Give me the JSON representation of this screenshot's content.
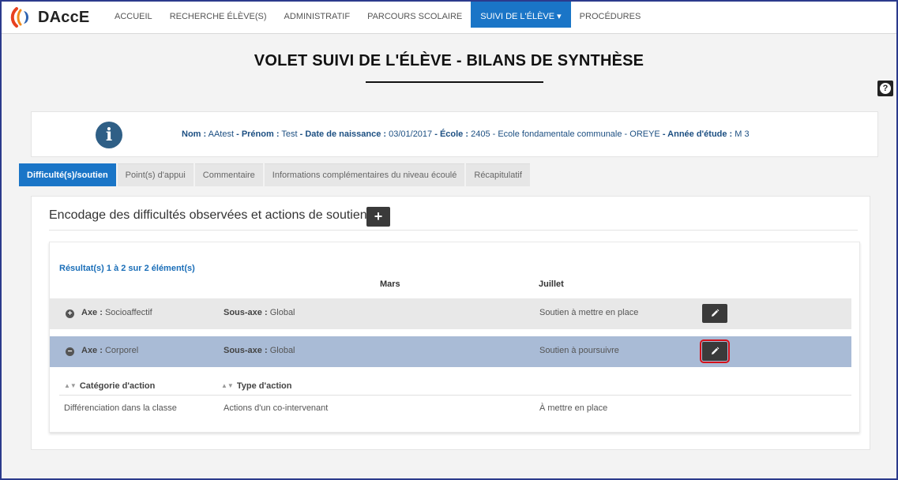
{
  "colors": {
    "frame_border": "#2b3a8c",
    "primary": "#1a75c7",
    "selected_row": "#a9bbd6",
    "highlight": "#d4111a"
  },
  "brand": {
    "name": "DAccE",
    "logo": "daccE-logo-icon"
  },
  "nav": {
    "items": [
      {
        "label": "ACCUEIL",
        "active": false
      },
      {
        "label": "RECHERCHE ÉLÈVE(S)",
        "active": false
      },
      {
        "label": "ADMINISTRATIF",
        "active": false
      },
      {
        "label": "PARCOURS SCOLAIRE",
        "active": false
      },
      {
        "label": "SUIVI DE L'ÉLÈVE ▾",
        "active": true
      },
      {
        "label": "PROCÉDURES",
        "active": false
      }
    ]
  },
  "help": {
    "icon": "question-icon",
    "label": "?"
  },
  "page": {
    "title": "VOLET SUIVI DE L'ÉLÈVE - BILANS DE SYNTHÈSE"
  },
  "student": {
    "icon": "info-icon",
    "nom_label": "Nom :",
    "nom": "AAtest",
    "prenom_label": "- Prénom :",
    "prenom": "Test",
    "naissance_label": "- Date de naissance :",
    "naissance": "03/01/2017",
    "ecole_label": "- École :",
    "ecole": "2405 - Ecole fondamentale communale - OREYE",
    "annee_label": "- Année d'étude :",
    "annee": "M 3"
  },
  "tabs": [
    {
      "label": "Difficulté(s)/soutien",
      "active": true
    },
    {
      "label": "Point(s) d'appui",
      "active": false
    },
    {
      "label": "Commentaire",
      "active": false
    },
    {
      "label": "Informations complémentaires du niveau écoulé",
      "active": false
    },
    {
      "label": "Récapitulatif",
      "active": false
    }
  ],
  "panel": {
    "heading": "Encodage des difficultés observées et actions de soutien",
    "add_label": "+",
    "result_count": "Résultat(s) 1 à 2 sur 2 élément(s)",
    "col_mars": "Mars",
    "col_juillet": "Juillet",
    "rows": [
      {
        "toggle": "+",
        "axe_label": "Axe :",
        "axe": "Socioaffectif",
        "sous_label": "Sous-axe :",
        "sous": "Global",
        "juillet": "Soutien à mettre en place"
      },
      {
        "toggle": "−",
        "axe_label": "Axe :",
        "axe": "Corporel",
        "sous_label": "Sous-axe :",
        "sous": "Global",
        "juillet": "Soutien à poursuivre"
      }
    ],
    "sub_table": {
      "headers": [
        "Catégorie d'action",
        "Type d'action"
      ],
      "cells": [
        "Différenciation dans la classe",
        "Actions d'un co-intervenant",
        "À mettre en place"
      ]
    }
  }
}
